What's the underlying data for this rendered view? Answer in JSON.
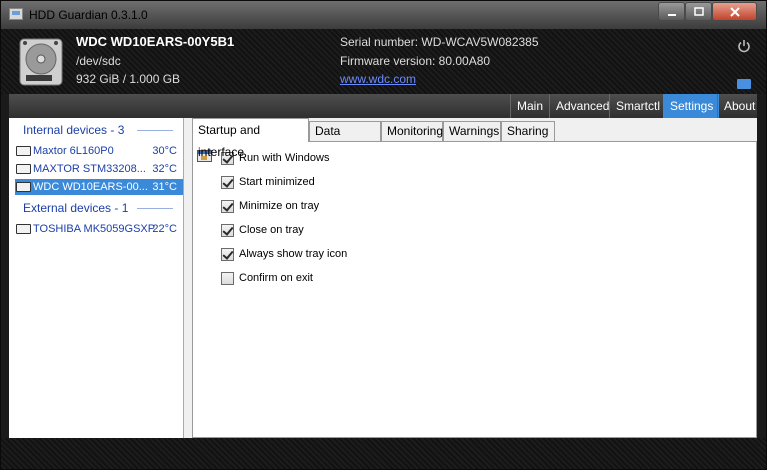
{
  "window": {
    "title": "HDD Guardian 0.3.1.0"
  },
  "header": {
    "model": "WDC WD10EARS-00Y5B1",
    "device": "/dev/sdc",
    "capacity": "932 GiB / 1.000 GB",
    "serial": "Serial number: WD-WCAV5W082385",
    "firmware": "Firmware version: 80.00A80",
    "website": "www.wdc.com"
  },
  "nav": [
    "Main",
    "Advanced",
    "Smartctl",
    "Settings",
    "About"
  ],
  "nav_active": "Settings",
  "internal_devices": {
    "title": "Internal devices - 3",
    "items": [
      {
        "name": "Maxtor 6L160P0",
        "temp": "30°C"
      },
      {
        "name": "MAXTOR STM33208...",
        "temp": "32°C"
      },
      {
        "name": "WDC WD10EARS-00...",
        "temp": "31°C",
        "selected": true
      }
    ]
  },
  "external_devices": {
    "title": "External devices - 1",
    "items": [
      {
        "name": "TOSHIBA MK5059GSXP",
        "temp": "22°C"
      }
    ]
  },
  "tabs": [
    "Startup and interface",
    "Data update",
    "Monitoring",
    "Warnings",
    "Sharing"
  ],
  "active_tab": "Startup and interface",
  "options": [
    {
      "label": "Run with Windows",
      "checked": true
    },
    {
      "label": "Start minimized",
      "checked": true
    },
    {
      "label": "Minimize on tray",
      "checked": true
    },
    {
      "label": "Close on tray",
      "checked": true
    },
    {
      "label": "Always show tray icon",
      "checked": true
    },
    {
      "label": "Confirm on exit",
      "checked": false
    }
  ],
  "colors": {
    "accent": "#3b8ad9",
    "link": "#6a8cff",
    "device_text": "#1b3fa8"
  }
}
